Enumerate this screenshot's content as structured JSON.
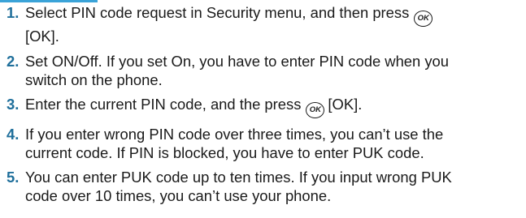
{
  "colors": {
    "accent": "#3aa3d8",
    "step_number": "#1f6f9b"
  },
  "icons": {
    "ok_key": "ok-key-icon"
  },
  "ok_key_label": "OK",
  "steps": [
    {
      "number": "1.",
      "line1": "Select PIN code request in Security menu, and then press",
      "line1_after_icon": "",
      "line2": "[OK]."
    },
    {
      "number": "2.",
      "line1": "Set ON/Off. If you set On, you have to enter PIN code when you",
      "line2": "switch on the phone."
    },
    {
      "number": "3.",
      "line1": "Enter the current PIN code, and the press",
      "line1_after_icon": "[OK]."
    },
    {
      "number": "4.",
      "line1": "If you enter wrong PIN code over three times, you can’t use the",
      "line2": "current code. If PIN is blocked, you have to enter PUK code."
    },
    {
      "number": "5.",
      "line1": "You can enter PUK code up to ten times. If you input wrong PUK",
      "line2": "code over 10 times, you can’t use your phone."
    }
  ]
}
